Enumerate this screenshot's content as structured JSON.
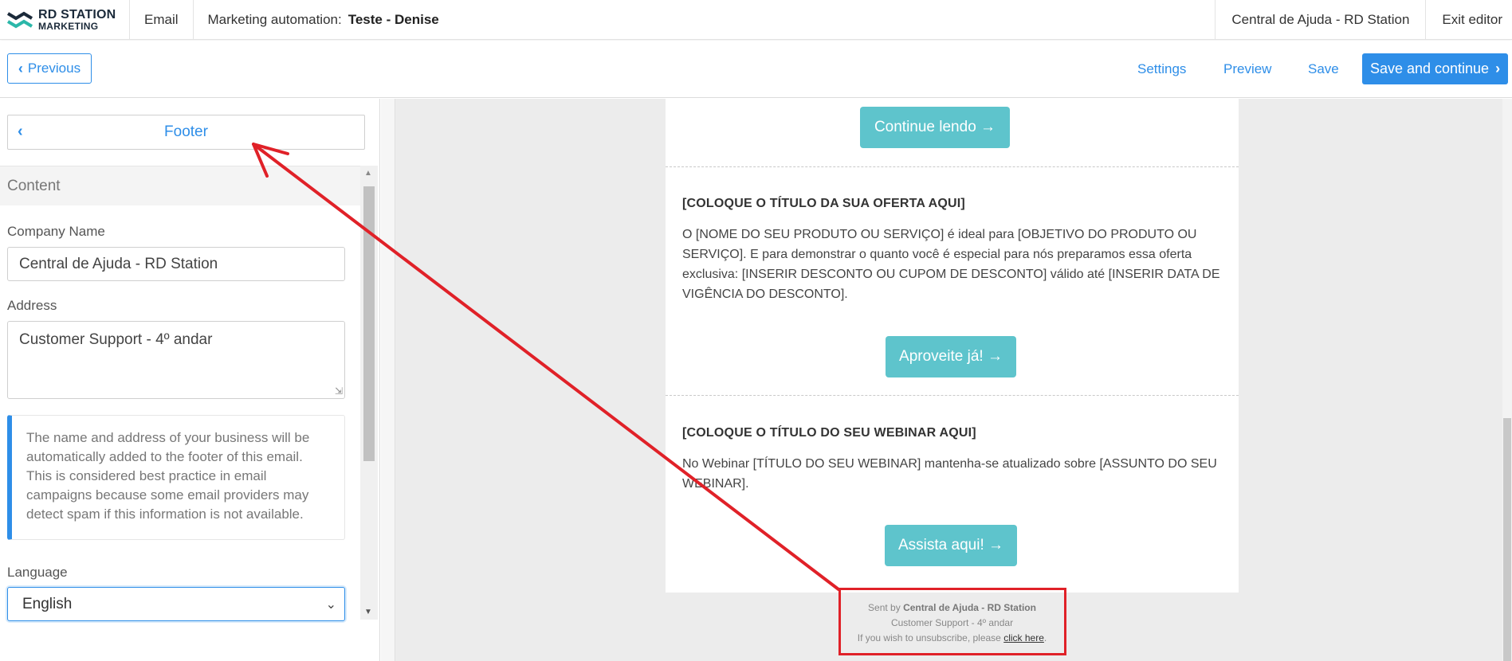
{
  "topbar": {
    "logo_line1": "RD STATION",
    "logo_line2": "MARKETING",
    "email_label": "Email",
    "automation_label": "Marketing automation:",
    "automation_name": "Teste - Denise",
    "help_link": "Central de Ajuda - RD Station",
    "exit_label": "Exit editor"
  },
  "actions": {
    "previous_label": "Previous",
    "settings_label": "Settings",
    "preview_label": "Preview",
    "save_label": "Save",
    "save_continue_label": "Save and continue"
  },
  "sidebar": {
    "section_title": "Footer",
    "content_header": "Content",
    "company_label": "Company Name",
    "company_value": "Central de Ajuda - RD Station",
    "address_label": "Address",
    "address_value": "Customer Support - 4º andar",
    "info_text": "The name and address of your business will be automatically added to the footer of this email. This is considered best practice in email campaigns because some email providers may detect spam if this information is not available.",
    "language_label": "Language",
    "language_value": "English"
  },
  "email": {
    "cta1": "Continue lendo →",
    "offer_title": "[COLOQUE O TÍTULO DA SUA OFERTA AQUI]",
    "offer_body": "O [NOME DO SEU PRODUTO OU SERVIÇO] é ideal para [OBJETIVO DO PRODUTO OU SERVIÇO]. E para demonstrar o quanto você é especial para nós preparamos essa oferta exclusiva: [INSERIR DESCONTO OU CUPOM DE DESCONTO] válido até [INSERIR DATA DE VIGÊNCIA DO DESCONTO].",
    "cta2": "Aproveite já! →",
    "webinar_title": "[COLOQUE O TÍTULO DO SEU WEBINAR AQUI]",
    "webinar_body": "No Webinar [TÍTULO DO SEU WEBINAR] mantenha-se atualizado sobre [ASSUNTO DO SEU WEBINAR].",
    "cta3": "Assista aqui! →",
    "footer_sent_by": "Sent by",
    "footer_company": "Central de Ajuda - RD Station",
    "footer_address": "Customer Support - 4º andar",
    "footer_unsub_prefix": "If you wish to unsubscribe, please",
    "footer_unsub_link": "click here",
    "footer_unsub_suffix": "."
  },
  "colors": {
    "primary": "#2e8ee8",
    "cta": "#5ec4cc",
    "annotation": "#e02128"
  },
  "icons": {
    "previous": "chevron-left-icon",
    "save_continue": "chevron-right-icon",
    "footer_back": "chevron-left-icon",
    "language_dropdown": "chevron-down-icon"
  }
}
